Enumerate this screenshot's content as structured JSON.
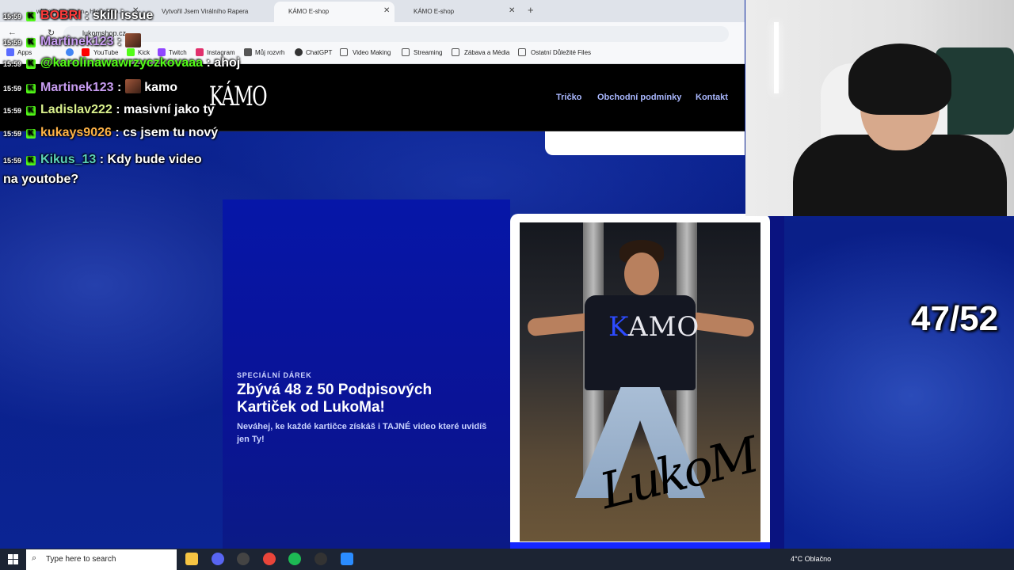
{
  "browser": {
    "tabs": [
      {
        "title": "white top women - Hledat Go..."
      },
      {
        "title": "Vytvořil Jsem Virálního Rapera"
      },
      {
        "title": "KÁMO E-shop"
      },
      {
        "title": "KÁMO E-shop"
      }
    ],
    "new_tab": "+",
    "url": "lukomshop.cz",
    "bookmarks": [
      {
        "label": "Apps",
        "icon": "apps-grid-icon"
      },
      {
        "label": "",
        "icon": "google-icon"
      },
      {
        "label": "YouTube",
        "icon": "youtube-icon"
      },
      {
        "label": "Kick",
        "icon": "kick-icon"
      },
      {
        "label": "Twitch",
        "icon": "twitch-icon"
      },
      {
        "label": "Instagram",
        "icon": "instagram-icon"
      },
      {
        "label": "Můj rozvrh",
        "icon": "schedule-icon"
      },
      {
        "label": "ChatGPT",
        "icon": "chatgpt-icon"
      },
      {
        "label": "Video Making",
        "icon": "folder-icon"
      },
      {
        "label": "Streaming",
        "icon": "folder-icon"
      },
      {
        "label": "Zábava a Média",
        "icon": "folder-icon"
      },
      {
        "label": "Ostatní Důležité Files",
        "icon": "folder-icon"
      }
    ]
  },
  "site": {
    "logo": "KÁMO",
    "nav": [
      "Tričko",
      "Obchodní podmínky",
      "Kontakt"
    ],
    "hero": {
      "eyebrow": "SPECIÁLNÍ DÁREK",
      "title": "Zbývá 48 z 50 Podpisových Kartiček od LukoMa!",
      "description": "Neváhej, ke každé kartičce získáš i TAJNÉ video které uvidíš jen Ty!"
    },
    "card": {
      "shirt_text_k": "K",
      "shirt_text_rest": "AMO",
      "signature": "LukoM"
    }
  },
  "chat": [
    {
      "time": "15:59",
      "user": "BOBRI",
      "message": "skill issue",
      "color": "#ff3b3b"
    },
    {
      "time": "15:59",
      "user": "Martinek123",
      "message": "",
      "color": "#c79cf0"
    },
    {
      "time": "15:59",
      "user": "@karolinawawrzyczkovaaa",
      "message": "ahoj",
      "color": "#53fc18"
    },
    {
      "time": "15:59",
      "user": "Martinek123",
      "message": "kamo",
      "color": "#c79cf0"
    },
    {
      "time": "15:59",
      "user": "Ladislav222",
      "message": "masivní jako ty",
      "color": "#d9f08c"
    },
    {
      "time": "15:59",
      "user": "kukays9026",
      "message": "cs jsem tu nový",
      "color": "#ffb347"
    },
    {
      "time": "15:59",
      "user": "Kikus_13",
      "message": "Kdy bude video na youtobe?",
      "color": "#5ad1b8"
    }
  ],
  "counter": "47/52",
  "taskbar": {
    "search_placeholder": "Type here to search",
    "weather": "4°C  Oblačno",
    "apps": [
      "file-explorer-icon",
      "discord-icon",
      "obs-icon",
      "chrome-icon",
      "spotify-icon",
      "obs-studio-icon",
      "app-icon"
    ]
  }
}
